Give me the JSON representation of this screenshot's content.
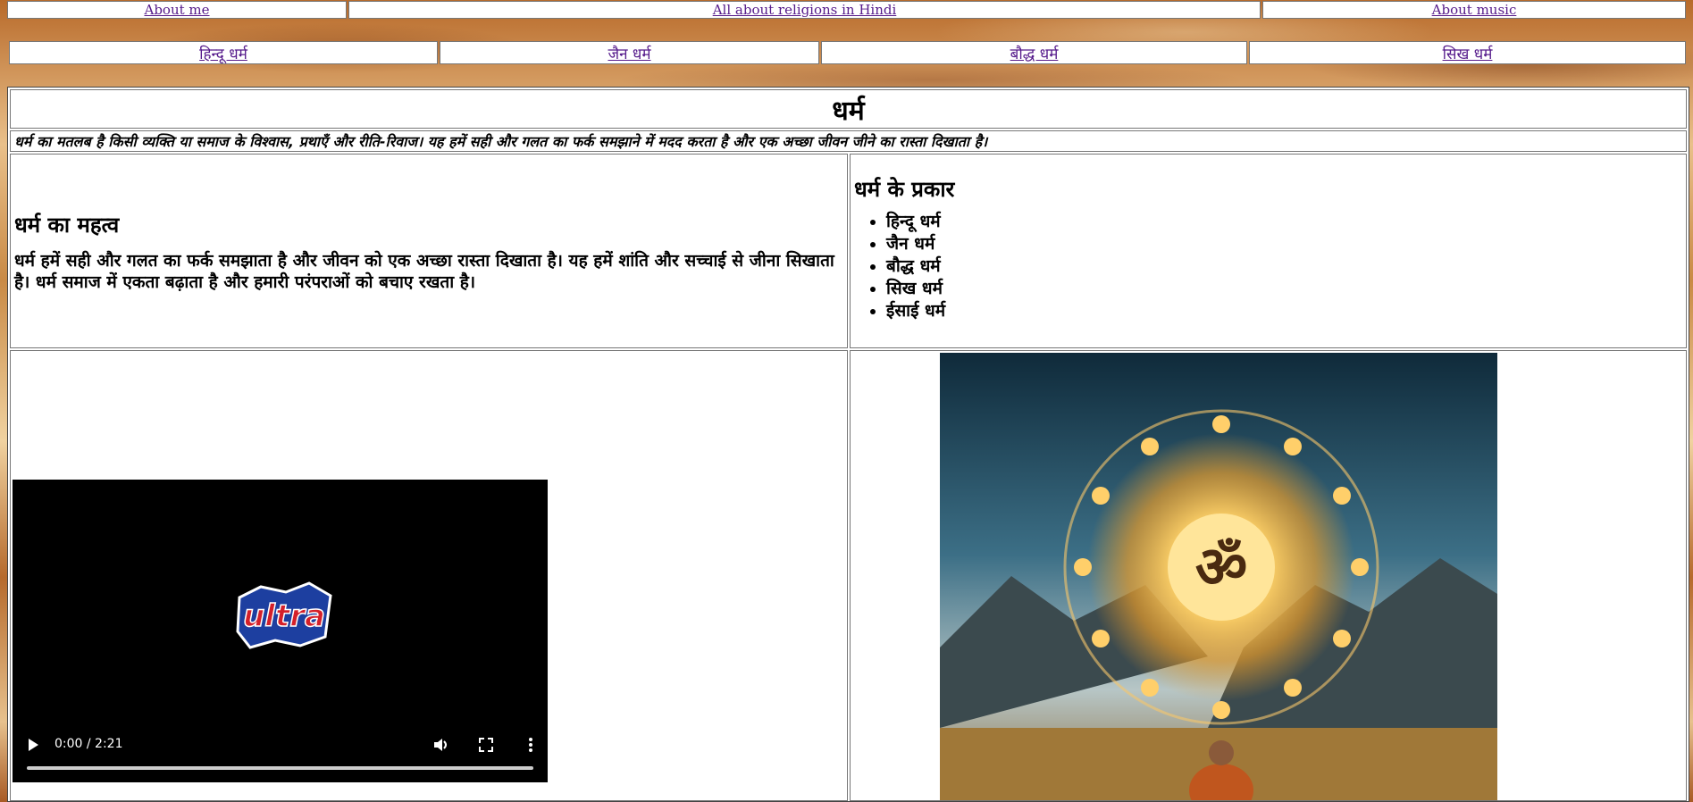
{
  "top_nav": {
    "about_me": "About me",
    "religions_hindi": "All about religions in Hindi",
    "about_music": "About music"
  },
  "religion_nav": [
    {
      "label": "हिन्दू धर्म"
    },
    {
      "label": "जैन धर्म"
    },
    {
      "label": "बौद्ध धर्म"
    },
    {
      "label": "सिख धर्म"
    }
  ],
  "page": {
    "title": "धर्म",
    "intro": "धर्म का मतलब है किसी व्यक्ति या समाज के विश्वास, प्रथाएँ और रीति-रिवाज। यह हमें सही और गलत का फर्क समझाने में मदद करता है और एक अच्छा जीवन जीने का रास्ता दिखाता है।"
  },
  "importance": {
    "heading": "धर्म का महत्व",
    "text": "धर्म हमें सही और गलत का फर्क समझाता है और जीवन को एक अच्छा रास्ता दिखाता है। यह हमें शांति और सच्चाई से जीना सिखाता है। धर्म समाज में एकता बढ़ाता है और हमारी परंपराओं को बचाए रखता है।"
  },
  "types": {
    "heading": "धर्म के प्रकार",
    "items": [
      "हिन्दू धर्म",
      "जैन धर्म",
      "बौद्ध धर्म",
      "सिख धर्म",
      "ईसाई धर्म"
    ]
  },
  "video": {
    "time": "0:00 / 2:21",
    "logo_text": "ultra",
    "play_icon": "play-icon",
    "volume_icon": "volume-icon",
    "fullscreen_icon": "fullscreen-icon",
    "more_icon": "more-options-icon",
    "progress": 0
  },
  "image": {
    "symbol": "ॐ"
  },
  "colors": {
    "link": "#551a8b",
    "video_bg": "#000000"
  }
}
